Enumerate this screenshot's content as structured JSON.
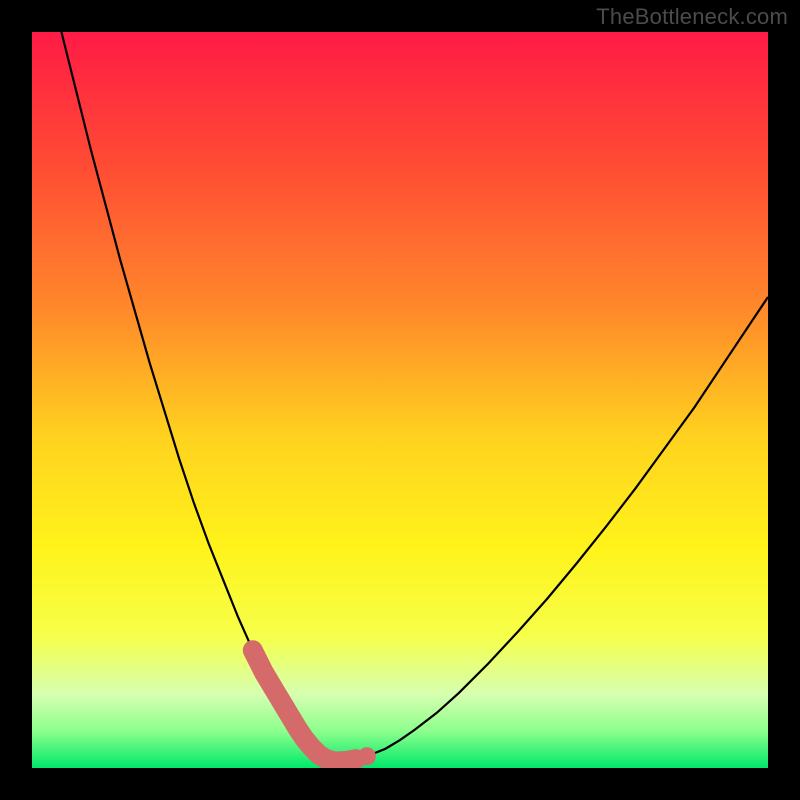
{
  "watermark": "TheBottleneck.com",
  "chart_data": {
    "type": "line",
    "title": "",
    "xlabel": "",
    "ylabel": "",
    "xlim": [
      0,
      100
    ],
    "ylim": [
      0,
      100
    ],
    "series": [
      {
        "name": "bottleneck-curve",
        "x": [
          4,
          6,
          8,
          10,
          12,
          14,
          16,
          18,
          20,
          22,
          24,
          26,
          28,
          30,
          31.5,
          33,
          34.5,
          36,
          37,
          38,
          39,
          40,
          41,
          42,
          44,
          46,
          48,
          50,
          52,
          55,
          58,
          62,
          66,
          70,
          74,
          78,
          82,
          86,
          90,
          94,
          98,
          100
        ],
        "y": [
          100,
          92,
          84,
          76.5,
          69,
          62,
          55,
          48.5,
          42,
          36,
          30.5,
          25.5,
          20.5,
          16,
          13,
          10.5,
          8,
          5.5,
          4,
          2.8,
          1.8,
          1.2,
          0.9,
          0.9,
          1.2,
          1.8,
          2.6,
          3.8,
          5.2,
          7.5,
          10.2,
          14.2,
          18.5,
          23,
          27.8,
          32.8,
          38,
          43.5,
          49,
          55,
          61,
          64
        ]
      }
    ],
    "thick_band": {
      "name": "bottleneck-minimum-band",
      "color": "#d46a6a",
      "x": [
        30,
        31.5,
        33,
        34.5,
        36,
        37,
        38,
        39,
        40,
        41,
        42,
        43,
        44
      ],
      "y": [
        16,
        13,
        10.5,
        8,
        5.5,
        4,
        2.8,
        1.8,
        1.2,
        0.9,
        0.9,
        1.0,
        1.2
      ]
    },
    "dot": {
      "x": 45.5,
      "y": 1.6,
      "color": "#d46a6a"
    },
    "gradient_stops": [
      {
        "offset": 0.0,
        "color": "#ff1b46"
      },
      {
        "offset": 0.18,
        "color": "#ff4b34"
      },
      {
        "offset": 0.38,
        "color": "#ff8a2a"
      },
      {
        "offset": 0.55,
        "color": "#ffd21f"
      },
      {
        "offset": 0.7,
        "color": "#fff31a"
      },
      {
        "offset": 0.82,
        "color": "#f6ff4a"
      },
      {
        "offset": 0.9,
        "color": "#d6ffb0"
      },
      {
        "offset": 0.95,
        "color": "#8cff8c"
      },
      {
        "offset": 1.0,
        "color": "#00e86b"
      }
    ]
  }
}
